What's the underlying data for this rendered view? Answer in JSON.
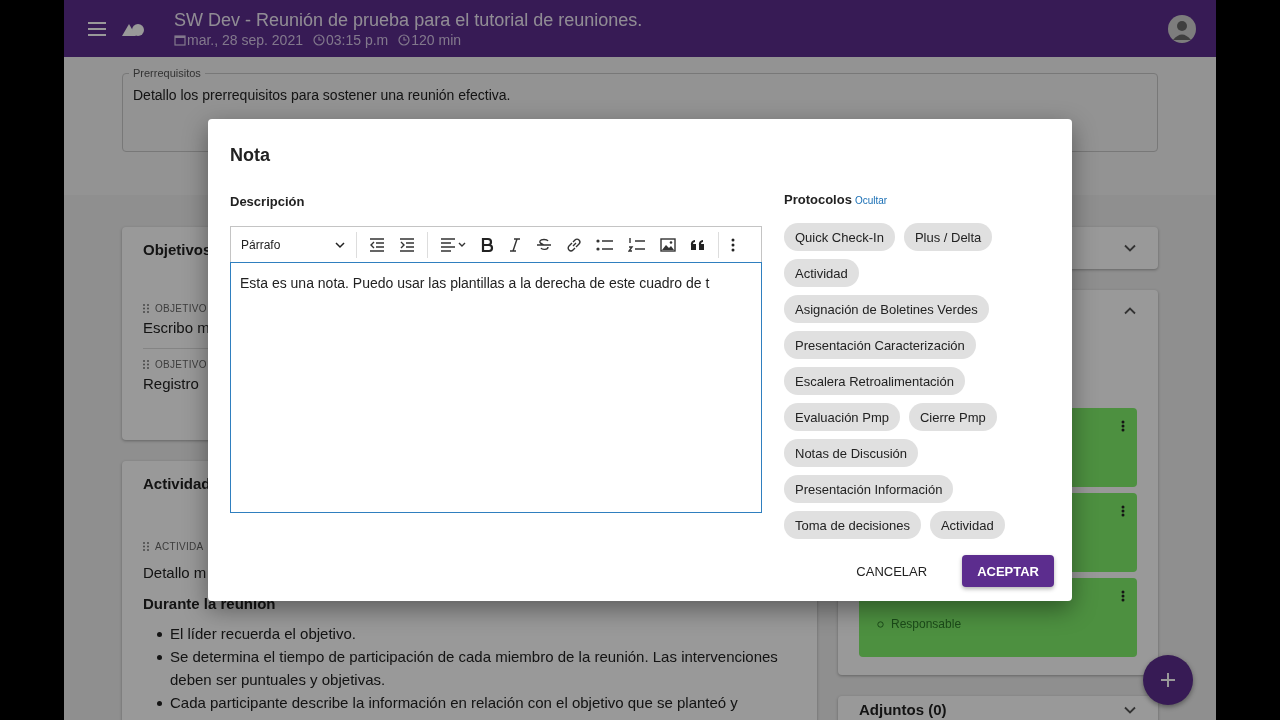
{
  "header": {
    "title": "SW Dev - Reunión de prueba para el tutorial de reuniones.",
    "date": "mar., 28 sep. 2021",
    "time": "03:15 p.m",
    "duration": "120 min"
  },
  "prerequisites": {
    "label": "Prerrequisitos",
    "text": "Detallo los prerrequisitos para sostener una reunión efectiva."
  },
  "objectives_card": {
    "title": "Objetivos",
    "items": [
      {
        "tag": "OBJETIVO",
        "text": "Escribo m"
      },
      {
        "tag": "OBJETIVO",
        "text": "Registro"
      }
    ]
  },
  "activities_card": {
    "title": "Actividad",
    "tag": "ACTIVIDA",
    "text": "Detallo m",
    "heading": "Durante la reunión",
    "bullets": [
      "El líder recuerda el objetivo.",
      "Se determina el tiempo de participación de cada miembro de la reunión. Las intervenciones deben ser puntuales y objetivas.",
      "Cada participante describe la información en relación con el objetivo que se planteó y"
    ]
  },
  "side_panel": {
    "collapsed_card": {
      "expanded": false
    },
    "tasks_card": {
      "expanded": true,
      "tasks": [
        {
          "kind": "card"
        },
        {
          "kind": "card"
        },
        {
          "kind": "card",
          "note": "Responsable"
        }
      ]
    },
    "attachments": {
      "title": "Adjuntos (0)",
      "expanded": false
    }
  },
  "dialog": {
    "title": "Nota",
    "description_label": "Descripción",
    "block_format": "Párrafo",
    "content": "Esta es una nota. Puedo usar las plantillas a la derecha de este cuadro de t",
    "protocols_label": "Protocolos",
    "hide_link": "Ocultar",
    "protocols": [
      "Quick Check-In",
      "Plus / Delta",
      "Actividad",
      "Asignación de Boletines Verdes",
      "Presentación Caracterización",
      "Escalera Retroalimentación",
      "Evaluación Pmp",
      "Cierre Pmp",
      "Notas de Discusión",
      "Presentación Información",
      "Toma de decisiones",
      "Actividad"
    ],
    "buttons": [
      {
        "label": "CANCELAR",
        "kind": "text"
      },
      {
        "label": "ACEPTAR",
        "kind": "primary"
      }
    ]
  }
}
